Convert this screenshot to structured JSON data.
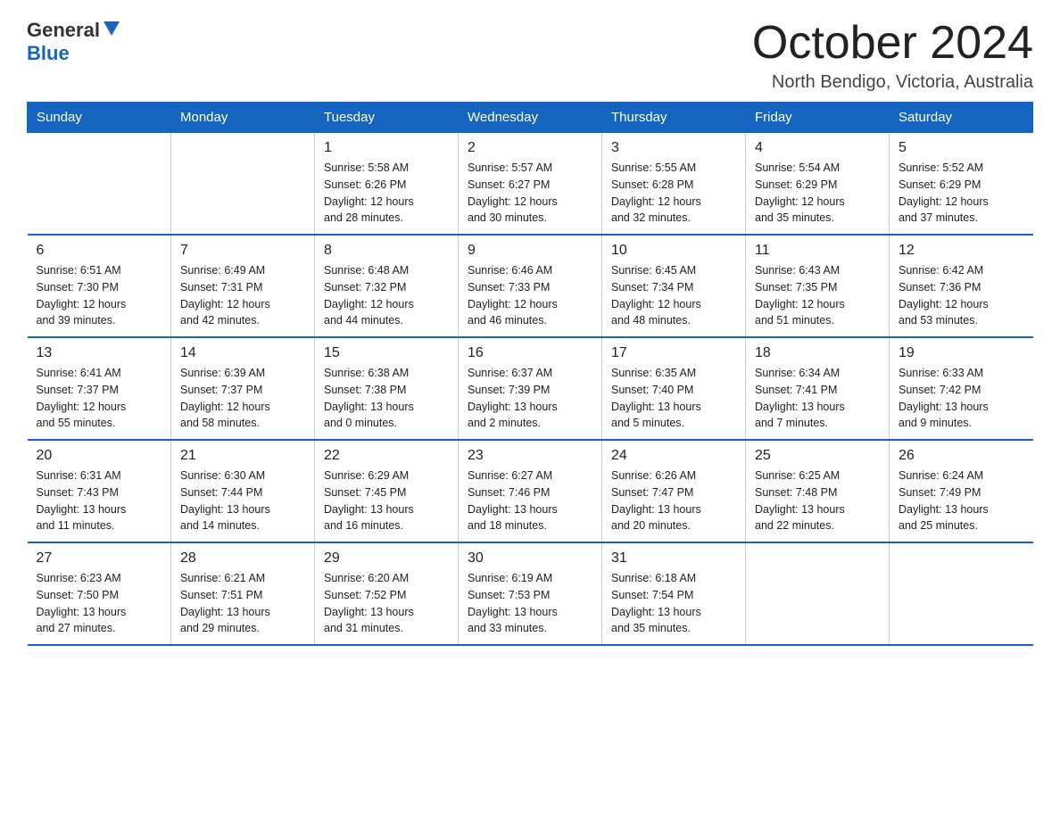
{
  "header": {
    "logo_general": "General",
    "logo_blue": "Blue",
    "month_title": "October 2024",
    "location": "North Bendigo, Victoria, Australia"
  },
  "days_of_week": [
    "Sunday",
    "Monday",
    "Tuesday",
    "Wednesday",
    "Thursday",
    "Friday",
    "Saturday"
  ],
  "weeks": [
    [
      {
        "day": "",
        "info": ""
      },
      {
        "day": "",
        "info": ""
      },
      {
        "day": "1",
        "info": "Sunrise: 5:58 AM\nSunset: 6:26 PM\nDaylight: 12 hours\nand 28 minutes."
      },
      {
        "day": "2",
        "info": "Sunrise: 5:57 AM\nSunset: 6:27 PM\nDaylight: 12 hours\nand 30 minutes."
      },
      {
        "day": "3",
        "info": "Sunrise: 5:55 AM\nSunset: 6:28 PM\nDaylight: 12 hours\nand 32 minutes."
      },
      {
        "day": "4",
        "info": "Sunrise: 5:54 AM\nSunset: 6:29 PM\nDaylight: 12 hours\nand 35 minutes."
      },
      {
        "day": "5",
        "info": "Sunrise: 5:52 AM\nSunset: 6:29 PM\nDaylight: 12 hours\nand 37 minutes."
      }
    ],
    [
      {
        "day": "6",
        "info": "Sunrise: 6:51 AM\nSunset: 7:30 PM\nDaylight: 12 hours\nand 39 minutes."
      },
      {
        "day": "7",
        "info": "Sunrise: 6:49 AM\nSunset: 7:31 PM\nDaylight: 12 hours\nand 42 minutes."
      },
      {
        "day": "8",
        "info": "Sunrise: 6:48 AM\nSunset: 7:32 PM\nDaylight: 12 hours\nand 44 minutes."
      },
      {
        "day": "9",
        "info": "Sunrise: 6:46 AM\nSunset: 7:33 PM\nDaylight: 12 hours\nand 46 minutes."
      },
      {
        "day": "10",
        "info": "Sunrise: 6:45 AM\nSunset: 7:34 PM\nDaylight: 12 hours\nand 48 minutes."
      },
      {
        "day": "11",
        "info": "Sunrise: 6:43 AM\nSunset: 7:35 PM\nDaylight: 12 hours\nand 51 minutes."
      },
      {
        "day": "12",
        "info": "Sunrise: 6:42 AM\nSunset: 7:36 PM\nDaylight: 12 hours\nand 53 minutes."
      }
    ],
    [
      {
        "day": "13",
        "info": "Sunrise: 6:41 AM\nSunset: 7:37 PM\nDaylight: 12 hours\nand 55 minutes."
      },
      {
        "day": "14",
        "info": "Sunrise: 6:39 AM\nSunset: 7:37 PM\nDaylight: 12 hours\nand 58 minutes."
      },
      {
        "day": "15",
        "info": "Sunrise: 6:38 AM\nSunset: 7:38 PM\nDaylight: 13 hours\nand 0 minutes."
      },
      {
        "day": "16",
        "info": "Sunrise: 6:37 AM\nSunset: 7:39 PM\nDaylight: 13 hours\nand 2 minutes."
      },
      {
        "day": "17",
        "info": "Sunrise: 6:35 AM\nSunset: 7:40 PM\nDaylight: 13 hours\nand 5 minutes."
      },
      {
        "day": "18",
        "info": "Sunrise: 6:34 AM\nSunset: 7:41 PM\nDaylight: 13 hours\nand 7 minutes."
      },
      {
        "day": "19",
        "info": "Sunrise: 6:33 AM\nSunset: 7:42 PM\nDaylight: 13 hours\nand 9 minutes."
      }
    ],
    [
      {
        "day": "20",
        "info": "Sunrise: 6:31 AM\nSunset: 7:43 PM\nDaylight: 13 hours\nand 11 minutes."
      },
      {
        "day": "21",
        "info": "Sunrise: 6:30 AM\nSunset: 7:44 PM\nDaylight: 13 hours\nand 14 minutes."
      },
      {
        "day": "22",
        "info": "Sunrise: 6:29 AM\nSunset: 7:45 PM\nDaylight: 13 hours\nand 16 minutes."
      },
      {
        "day": "23",
        "info": "Sunrise: 6:27 AM\nSunset: 7:46 PM\nDaylight: 13 hours\nand 18 minutes."
      },
      {
        "day": "24",
        "info": "Sunrise: 6:26 AM\nSunset: 7:47 PM\nDaylight: 13 hours\nand 20 minutes."
      },
      {
        "day": "25",
        "info": "Sunrise: 6:25 AM\nSunset: 7:48 PM\nDaylight: 13 hours\nand 22 minutes."
      },
      {
        "day": "26",
        "info": "Sunrise: 6:24 AM\nSunset: 7:49 PM\nDaylight: 13 hours\nand 25 minutes."
      }
    ],
    [
      {
        "day": "27",
        "info": "Sunrise: 6:23 AM\nSunset: 7:50 PM\nDaylight: 13 hours\nand 27 minutes."
      },
      {
        "day": "28",
        "info": "Sunrise: 6:21 AM\nSunset: 7:51 PM\nDaylight: 13 hours\nand 29 minutes."
      },
      {
        "day": "29",
        "info": "Sunrise: 6:20 AM\nSunset: 7:52 PM\nDaylight: 13 hours\nand 31 minutes."
      },
      {
        "day": "30",
        "info": "Sunrise: 6:19 AM\nSunset: 7:53 PM\nDaylight: 13 hours\nand 33 minutes."
      },
      {
        "day": "31",
        "info": "Sunrise: 6:18 AM\nSunset: 7:54 PM\nDaylight: 13 hours\nand 35 minutes."
      },
      {
        "day": "",
        "info": ""
      },
      {
        "day": "",
        "info": ""
      }
    ]
  ]
}
